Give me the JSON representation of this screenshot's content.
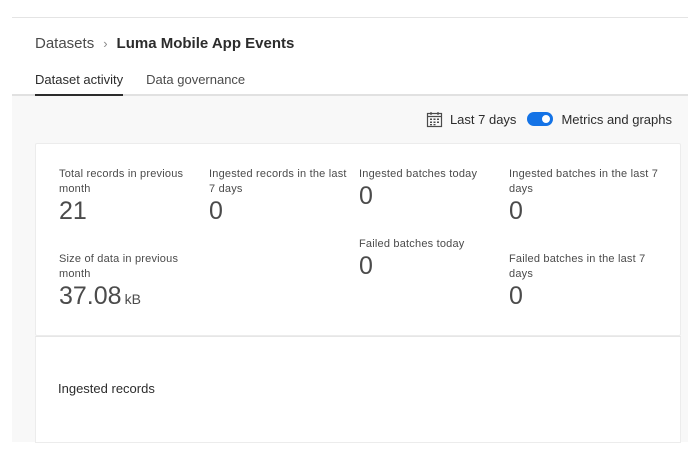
{
  "breadcrumb": {
    "parent": "Datasets",
    "separator": "›",
    "current": "Luma Mobile App Events"
  },
  "tabs": [
    {
      "label": "Dataset activity",
      "selected": true
    },
    {
      "label": "Data governance",
      "selected": false
    }
  ],
  "toolbar": {
    "date_range_label": "Last 7 days",
    "date_icon": "calendar-icon",
    "toggle_label": "Metrics and graphs",
    "toggle_on": true,
    "accent_color": "#1473e6"
  },
  "metrics": {
    "total_records": {
      "label": "Total records in previous month",
      "value": "21"
    },
    "ingested_records_7d": {
      "label": "Ingested records in the last 7 days",
      "value": "0"
    },
    "ingested_batches_today": {
      "label": "Ingested batches today",
      "value": "0"
    },
    "ingested_batches_7d": {
      "label": "Ingested batches in the last 7 days",
      "value": "0"
    },
    "size_of_data": {
      "label": "Size of data in previous month",
      "value": "37.08",
      "unit": "kB"
    },
    "failed_batches_today": {
      "label": "Failed batches today",
      "value": "0"
    },
    "failed_batches_7d": {
      "label": "Failed batches in the last 7 days",
      "value": "0"
    }
  },
  "chart_section": {
    "title": "Ingested records"
  }
}
